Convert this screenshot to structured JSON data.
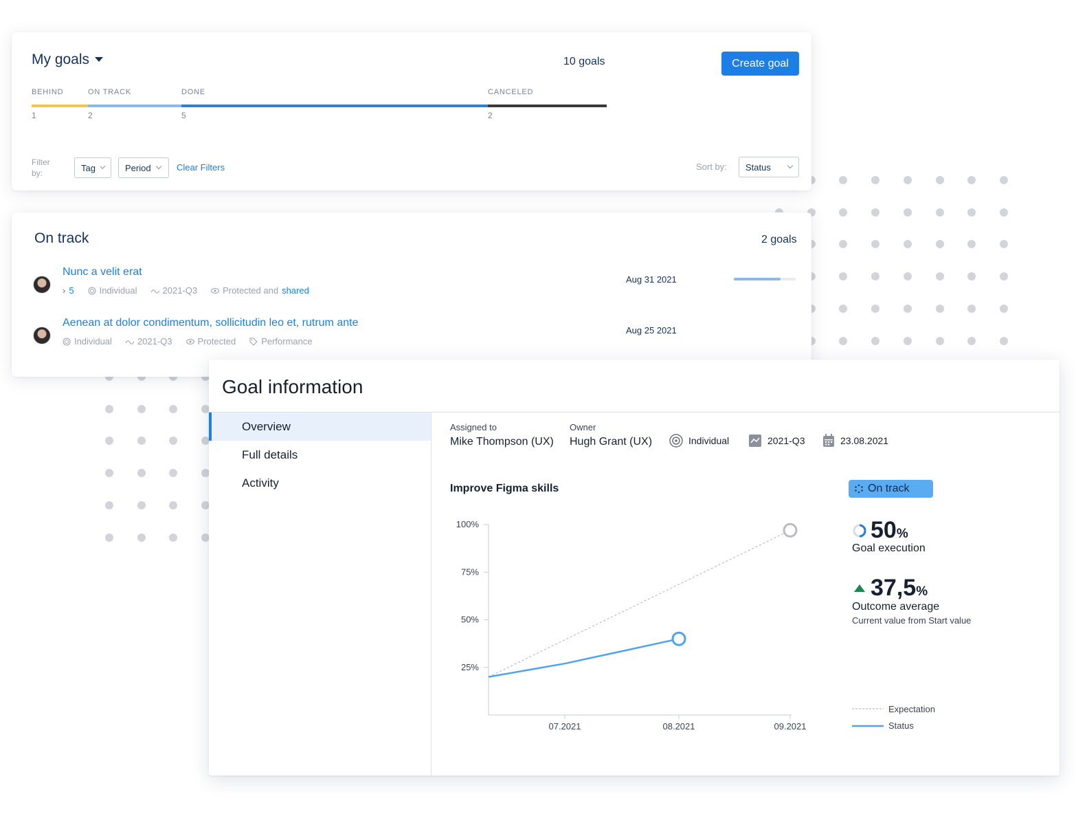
{
  "my_goals": {
    "title": "My goals",
    "count_label": "10 goals",
    "create_button": "Create goal",
    "segments": [
      {
        "label": "BEHIND",
        "count": "1",
        "color": "#f2c64b",
        "fraction": 0.1
      },
      {
        "label": "ON TRACK",
        "count": "2",
        "color": "#8ab8ef",
        "fraction": 0.2
      },
      {
        "label": "DONE",
        "count": "5",
        "color": "#2f7ed8",
        "fraction": 0.5
      },
      {
        "label": "CANCELED",
        "count": "2",
        "color": "#3b3b3b",
        "fraction": 0.2
      }
    ],
    "filter_label": "Filter by:",
    "filters": [
      "Tag",
      "Period"
    ],
    "clear_filters": "Clear Filters",
    "sort_label": "Sort by:",
    "sort_value": "Status"
  },
  "on_track": {
    "title": "On track",
    "count_label": "2 goals",
    "goals": [
      {
        "name": "Nunc a velit erat",
        "children": "5",
        "type": "Individual",
        "period": "2021-Q3",
        "visibility_prefix": "Protected and",
        "visibility_emph": "shared",
        "date": "Aug 31 2021",
        "progress": 0.75
      },
      {
        "name": "Aenean at dolor condimentum, sollicitudin leo et, rutrum ante",
        "type": "Individual",
        "period": "2021-Q3",
        "visibility": "Protected",
        "tag": "Performance",
        "date": "Aug 25 2021"
      }
    ]
  },
  "goal_info": {
    "title": "Goal information",
    "nav": [
      "Overview",
      "Full details",
      "Activity"
    ],
    "assigned_label": "Assigned to",
    "assigned_value": "Mike Thompson (UX)",
    "owner_label": "Owner",
    "owner_value": "Hugh Grant (UX)",
    "type": "Individual",
    "period": "2021-Q3",
    "date": "23.08.2021",
    "chart_title": "Improve Figma skills",
    "status": "On track",
    "execution_value": "50",
    "execution_unit": "%",
    "execution_label": "Goal execution",
    "outcome_value": "37,5",
    "outcome_unit": "%",
    "outcome_label": "Outcome average",
    "outcome_sub": "Current value from Start value",
    "legend": {
      "expectation": "Expectation",
      "status": "Status"
    },
    "colors": {
      "accent": "#1b7fe6",
      "status_line": "#4ea3f0",
      "expectation": "#b9bcc4",
      "up_arrow": "#1a8a4a"
    }
  },
  "chart_data": {
    "type": "line",
    "title": "Improve Figma skills",
    "y_ticks": [
      "100%",
      "75%",
      "50%",
      "25%"
    ],
    "x_ticks": [
      "07.2021",
      "08.2021",
      "09.2021"
    ],
    "ylim": [
      0,
      100
    ],
    "series": [
      {
        "name": "Expectation",
        "x": [
          "06.2021",
          "09.2021"
        ],
        "values": [
          20,
          97
        ]
      },
      {
        "name": "Status",
        "x": [
          "06.2021",
          "07.2021",
          "08.2021"
        ],
        "values": [
          20,
          27,
          40
        ]
      }
    ]
  }
}
